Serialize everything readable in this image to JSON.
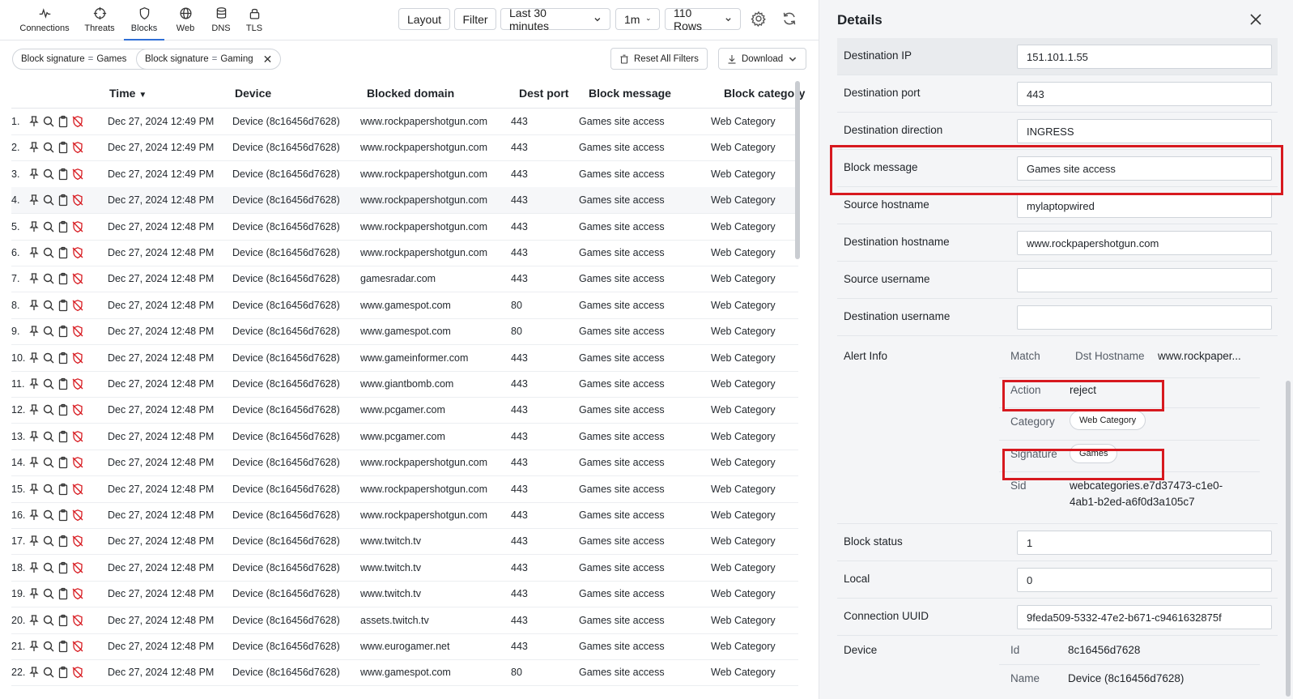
{
  "nav": {
    "tabs": [
      {
        "label": "Connections",
        "icon": "pulse-icon"
      },
      {
        "label": "Threats",
        "icon": "crosshair-icon"
      },
      {
        "label": "Blocks",
        "icon": "shield-icon"
      },
      {
        "label": "Web",
        "icon": "globe-icon"
      },
      {
        "label": "DNS",
        "icon": "database-icon"
      },
      {
        "label": "TLS",
        "icon": "lock-icon"
      }
    ],
    "active": "Blocks"
  },
  "toolbar": {
    "layout_label": "Layout",
    "filter_label": "Filter",
    "time_range": "Last 30 minutes",
    "interval": "1m",
    "rows": "110 Rows"
  },
  "filters": {
    "chips": [
      {
        "key": "Block signature",
        "op": "=",
        "value": "Games"
      },
      {
        "key": "Block signature",
        "op": "=",
        "value": "Gaming"
      }
    ],
    "reset_label": "Reset All Filters",
    "download_label": "Download"
  },
  "table": {
    "columns": {
      "time": "Time",
      "device": "Device",
      "domain": "Blocked domain",
      "port": "Dest port",
      "message": "Block message",
      "category": "Block category"
    },
    "rows": [
      {
        "n": "1.",
        "time": "Dec 27, 2024 12:49 PM",
        "device": "Device (8c16456d7628)",
        "domain": "www.rockpapershotgun.com",
        "port": "443",
        "message": "Games site access",
        "category": "Web Category"
      },
      {
        "n": "2.",
        "time": "Dec 27, 2024 12:49 PM",
        "device": "Device (8c16456d7628)",
        "domain": "www.rockpapershotgun.com",
        "port": "443",
        "message": "Games site access",
        "category": "Web Category"
      },
      {
        "n": "3.",
        "time": "Dec 27, 2024 12:49 PM",
        "device": "Device (8c16456d7628)",
        "domain": "www.rockpapershotgun.com",
        "port": "443",
        "message": "Games site access",
        "category": "Web Category"
      },
      {
        "n": "4.",
        "time": "Dec 27, 2024 12:48 PM",
        "device": "Device (8c16456d7628)",
        "domain": "www.rockpapershotgun.com",
        "port": "443",
        "message": "Games site access",
        "category": "Web Category"
      },
      {
        "n": "5.",
        "time": "Dec 27, 2024 12:48 PM",
        "device": "Device (8c16456d7628)",
        "domain": "www.rockpapershotgun.com",
        "port": "443",
        "message": "Games site access",
        "category": "Web Category"
      },
      {
        "n": "6.",
        "time": "Dec 27, 2024 12:48 PM",
        "device": "Device (8c16456d7628)",
        "domain": "www.rockpapershotgun.com",
        "port": "443",
        "message": "Games site access",
        "category": "Web Category"
      },
      {
        "n": "7.",
        "time": "Dec 27, 2024 12:48 PM",
        "device": "Device (8c16456d7628)",
        "domain": "gamesradar.com",
        "port": "443",
        "message": "Games site access",
        "category": "Web Category"
      },
      {
        "n": "8.",
        "time": "Dec 27, 2024 12:48 PM",
        "device": "Device (8c16456d7628)",
        "domain": "www.gamespot.com",
        "port": "80",
        "message": "Games site access",
        "category": "Web Category"
      },
      {
        "n": "9.",
        "time": "Dec 27, 2024 12:48 PM",
        "device": "Device (8c16456d7628)",
        "domain": "www.gamespot.com",
        "port": "80",
        "message": "Games site access",
        "category": "Web Category"
      },
      {
        "n": "10.",
        "time": "Dec 27, 2024 12:48 PM",
        "device": "Device (8c16456d7628)",
        "domain": "www.gameinformer.com",
        "port": "443",
        "message": "Games site access",
        "category": "Web Category"
      },
      {
        "n": "11.",
        "time": "Dec 27, 2024 12:48 PM",
        "device": "Device (8c16456d7628)",
        "domain": "www.giantbomb.com",
        "port": "443",
        "message": "Games site access",
        "category": "Web Category"
      },
      {
        "n": "12.",
        "time": "Dec 27, 2024 12:48 PM",
        "device": "Device (8c16456d7628)",
        "domain": "www.pcgamer.com",
        "port": "443",
        "message": "Games site access",
        "category": "Web Category"
      },
      {
        "n": "13.",
        "time": "Dec 27, 2024 12:48 PM",
        "device": "Device (8c16456d7628)",
        "domain": "www.pcgamer.com",
        "port": "443",
        "message": "Games site access",
        "category": "Web Category"
      },
      {
        "n": "14.",
        "time": "Dec 27, 2024 12:48 PM",
        "device": "Device (8c16456d7628)",
        "domain": "www.rockpapershotgun.com",
        "port": "443",
        "message": "Games site access",
        "category": "Web Category"
      },
      {
        "n": "15.",
        "time": "Dec 27, 2024 12:48 PM",
        "device": "Device (8c16456d7628)",
        "domain": "www.rockpapershotgun.com",
        "port": "443",
        "message": "Games site access",
        "category": "Web Category"
      },
      {
        "n": "16.",
        "time": "Dec 27, 2024 12:48 PM",
        "device": "Device (8c16456d7628)",
        "domain": "www.rockpapershotgun.com",
        "port": "443",
        "message": "Games site access",
        "category": "Web Category"
      },
      {
        "n": "17.",
        "time": "Dec 27, 2024 12:48 PM",
        "device": "Device (8c16456d7628)",
        "domain": "www.twitch.tv",
        "port": "443",
        "message": "Games site access",
        "category": "Web Category"
      },
      {
        "n": "18.",
        "time": "Dec 27, 2024 12:48 PM",
        "device": "Device (8c16456d7628)",
        "domain": "www.twitch.tv",
        "port": "443",
        "message": "Games site access",
        "category": "Web Category"
      },
      {
        "n": "19.",
        "time": "Dec 27, 2024 12:48 PM",
        "device": "Device (8c16456d7628)",
        "domain": "www.twitch.tv",
        "port": "443",
        "message": "Games site access",
        "category": "Web Category"
      },
      {
        "n": "20.",
        "time": "Dec 27, 2024 12:48 PM",
        "device": "Device (8c16456d7628)",
        "domain": "assets.twitch.tv",
        "port": "443",
        "message": "Games site access",
        "category": "Web Category"
      },
      {
        "n": "21.",
        "time": "Dec 27, 2024 12:48 PM",
        "device": "Device (8c16456d7628)",
        "domain": "www.eurogamer.net",
        "port": "443",
        "message": "Games site access",
        "category": "Web Category"
      },
      {
        "n": "22.",
        "time": "Dec 27, 2024 12:48 PM",
        "device": "Device (8c16456d7628)",
        "domain": "www.gamespot.com",
        "port": "80",
        "message": "Games site access",
        "category": "Web Category"
      }
    ]
  },
  "details": {
    "title": "Details",
    "fields": [
      {
        "label": "Destination IP",
        "value": "151.101.1.55"
      },
      {
        "label": "Destination port",
        "value": "443"
      },
      {
        "label": "Destination direction",
        "value": "INGRESS"
      },
      {
        "label": "Block message",
        "value": "Games site access"
      },
      {
        "label": "Source hostname",
        "value": "mylaptopwired"
      },
      {
        "label": "Destination hostname",
        "value": "www.rockpapershotgun.com"
      },
      {
        "label": "Source username",
        "value": ""
      },
      {
        "label": "Destination username",
        "value": ""
      }
    ],
    "alert_info": {
      "label": "Alert Info",
      "match_key": "Match",
      "dst_hostname_key": "Dst Hostname",
      "dst_hostname_value": "www.rockpaper...",
      "action_key": "Action",
      "action_value": "reject",
      "category_key": "Category",
      "category_value": "Web Category",
      "signature_key": "Signature",
      "signature_value": "Games",
      "sid_key": "Sid",
      "sid_line1": "webcategories.e7d37473-c1e0-",
      "sid_line2": "4ab1-b2ed-a6f0d3a105c7"
    },
    "fields2": [
      {
        "label": "Block status",
        "value": "1"
      },
      {
        "label": "Local",
        "value": "0"
      },
      {
        "label": "Connection UUID",
        "value": "9feda509-5332-47e2-b671-c9461632875f"
      }
    ],
    "device": {
      "label": "Device",
      "id_key": "Id",
      "id_value": "8c16456d7628",
      "name_key": "Name",
      "name_value": "Device (8c16456d7628)"
    }
  },
  "colors": {
    "accent": "#2f6fd6",
    "highlight_box": "#d7191f",
    "panel_bg": "#f4f5f7"
  }
}
